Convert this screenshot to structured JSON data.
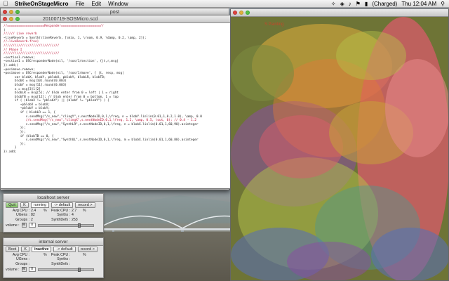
{
  "menubar": {
    "app_name": "StrikeOnStageMicro",
    "menus": [
      "File",
      "Edit",
      "Window"
    ],
    "battery": "(Charged)",
    "time": "Thu 12:04 AM"
  },
  "post_window": {
    "title": "post"
  },
  "editor_window": {
    "title": "20100719-SOSMicro.scd",
    "code_lines": [
      "//====================Responder=====================//",
      "(",
      "////// Live reverb",
      "~liveReverb = Synth(\\liveReverb, [\\mix, 1, \\room, 0.9, \\damp, 0.2, \\amp, 2]);",
      "//~liveReverb.free)",
      "",
      "//////////////////////////////",
      "// Phase I",
      "//////////////////////////////",
      "~section1.remove;",
      "~section1 = OSCresponderNode(nil, '/sos/1/section', {|t,r,msg|",
      "",
      "}).add;)",
      "",
      "",
      "~posimove.remove;",
      "~posimove = OSCresponderNode(nil, '/sos/1/move', { |t, resp, msg|",
      "      var blobX, blobY, pblobX, pblobY, blobLR, blobTB;",
      "      blobX = msg[10].round(0.003)",
      "      blobY = msg[11].round(0.003)",
      "      x = msg[3]1[2]",
      "      blobLR = msg[5]; // blob enter from 0 = left | 1 = right",
      "      blobTB = msg[12]; // blob enter from 0 = bottom, 1 = top",
      "",
      "      if ( (blobX != \"pblobX\") || (blobY != \"pblobY\") ) {",
      "         ~pblobX = blobX;",
      "         ~pblobY = blobY;",
      "         if ( blobLR == 1, {",
      "            s.sendMsg(\"/s_new\",\"clingY\",s.nextNodeID,0,1,\\freq, n = blobY.linlin(0.01,1,0.2,1.0), \\amp, 0.0",
      "            //s.sendMsg(\"/s_new\",\"clingX\",s.nextNodeID,0,1,\\freq, 1.2, \\amp, 0.5, \\out, 0); // 0.4 - 1.2",
      "            s.sendMsg(\"/s_new\",\"SynthLR\",s.nextNodeID,0,1,\\freq, n = blobX.linlin(0.01,1,60,90).asinteger",
      "         });",
      "         });",
      "         if (blobTB == 0, {",
      "            s.sendMsg(\"/s_new\",\"SynthUL\",s.nextNodeID,0,1,\\freq, m = blobX.linlin(0.01,1,60,80).asinteger",
      "         });",
      "      }",
      "",
      "}).add;"
    ]
  },
  "paint_window": {
    "label": "S Painting"
  },
  "localhost_server": {
    "title": "localhost server",
    "quit_label": "Quit",
    "k_label": "K",
    "status": "running",
    "default_label": "-> default",
    "record_label": "record >",
    "stats": [
      [
        "Avg CPU :",
        "2.4",
        "%",
        "Peak CPU :",
        "2.7",
        "%"
      ],
      [
        "UGens :",
        "82",
        "",
        "Synths :",
        "4",
        ""
      ],
      [
        "Groups :",
        "2",
        "",
        "SynthDefs :",
        "253",
        ""
      ]
    ],
    "volume_label": "volume :",
    "volume_m": "M",
    "volume_value": "0"
  },
  "internal_server": {
    "title": "internal server",
    "boot_label": "Boot",
    "k_label": "K",
    "status": "inactive",
    "default_label": "-> default",
    "record_label": "record >",
    "stats": [
      [
        "Avg CPU :",
        "",
        "%",
        "Peak CPU :",
        "",
        "%"
      ],
      [
        "UGens :",
        "",
        "",
        "Synths :",
        "",
        ""
      ],
      [
        "Groups :",
        "",
        "",
        "SynthDefs :",
        "",
        ""
      ]
    ],
    "volume_label": "volume :",
    "volume_m": "M",
    "volume_value": "0"
  },
  "colors": {
    "accent_quit": "#7fc060",
    "code_comment": "#bb1133",
    "paint_blobs": [
      "#d95b6b",
      "#c7a23a",
      "#7c8a3f",
      "#5a6fb0",
      "#8a4ca3",
      "#e07a3a",
      "#4e9a8f",
      "#b5c44a"
    ]
  }
}
